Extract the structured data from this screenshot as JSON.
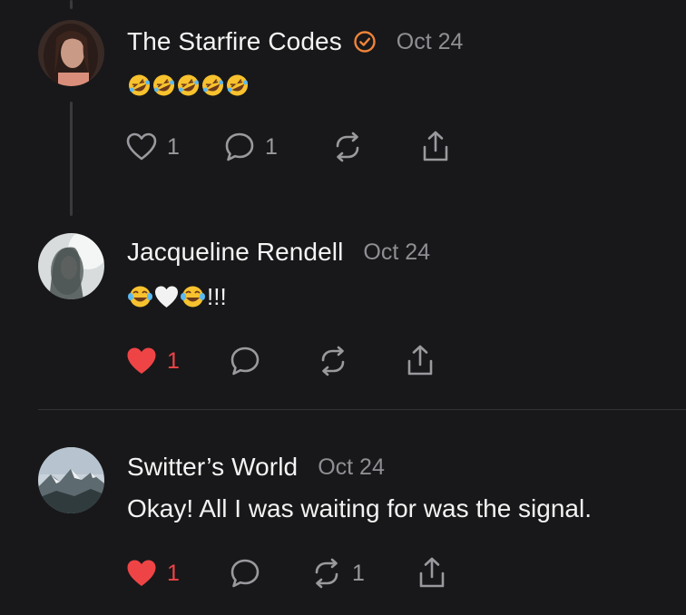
{
  "posts": [
    {
      "author": "The Starfire Codes",
      "verified": true,
      "date": "Oct 24",
      "text": "",
      "emoji": [
        "rolling-on-floor-laughing",
        "rolling-on-floor-laughing",
        "rolling-on-floor-laughing",
        "rolling-on-floor-laughing",
        "rolling-on-floor-laughing"
      ],
      "like_count": "1",
      "reply_count": "1",
      "repost_count": "",
      "liked": false,
      "icons": {
        "like": "heart-outline-icon",
        "reply": "speech-bubble-icon",
        "repost": "repost-icon",
        "share": "share-icon"
      }
    },
    {
      "author": "Jacqueline Rendell",
      "verified": false,
      "date": "Oct 24",
      "text": "!!!",
      "emoji": [
        "face-with-tears-of-joy",
        "white-heart",
        "face-with-tears-of-joy"
      ],
      "like_count": "1",
      "reply_count": "",
      "repost_count": "",
      "liked": true,
      "icons": {
        "like": "heart-filled-icon",
        "reply": "speech-bubble-icon",
        "repost": "repost-icon",
        "share": "share-icon"
      }
    },
    {
      "author": "Switter’s World",
      "verified": false,
      "date": "Oct 24",
      "text": "Okay! All I was waiting for was the signal.",
      "emoji": [],
      "like_count": "1",
      "reply_count": "",
      "repost_count": "1",
      "liked": true,
      "icons": {
        "like": "heart-filled-icon",
        "reply": "speech-bubble-icon",
        "repost": "repost-icon",
        "share": "share-icon"
      }
    }
  ],
  "colors": {
    "background": "#18181a",
    "like_active": "#ef4446",
    "verified_badge": "#f0843a",
    "muted_text": "#8e8e93",
    "icon": "#9a9a9e"
  }
}
